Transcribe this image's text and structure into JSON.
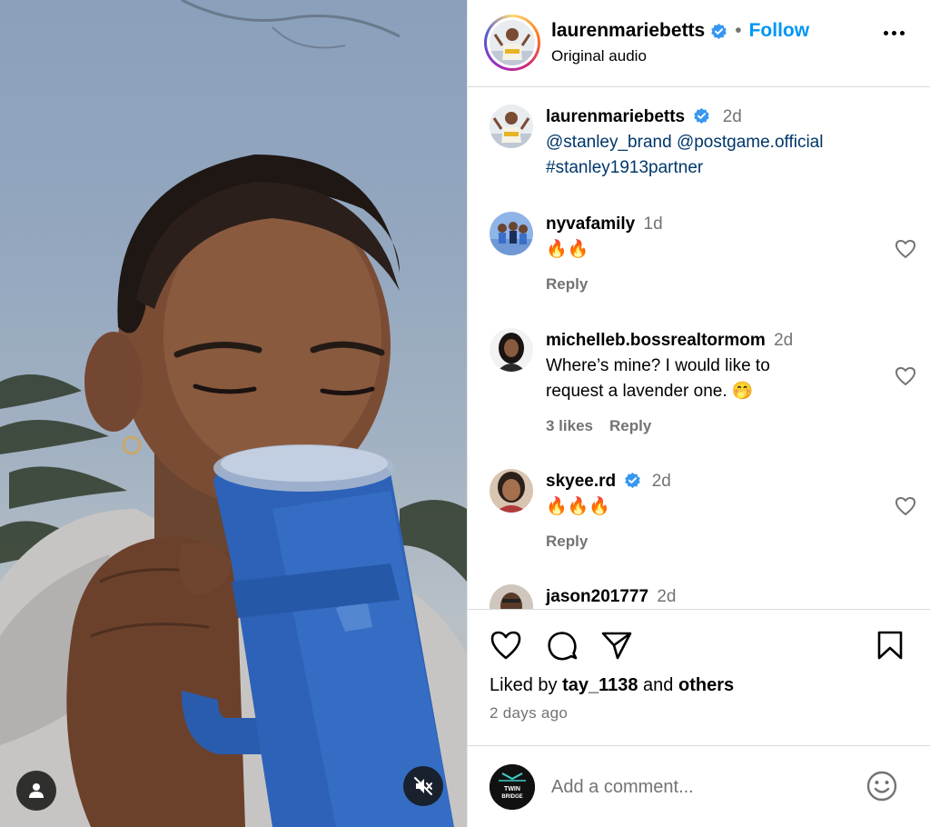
{
  "header": {
    "username": "laurenmariebetts",
    "separator": "•",
    "follow_label": "Follow",
    "audio_label": "Original audio"
  },
  "caption": {
    "username": "laurenmariebetts",
    "time": "2d",
    "mention_1": "@stanley_brand",
    "mention_2": "@postgame.official",
    "hashtag": "#stanley1913partner"
  },
  "comments": [
    {
      "username": "nyvafamily",
      "time": "1d",
      "text": "🔥🔥",
      "reply_label": "Reply"
    },
    {
      "username": "michelleb.bossrealtormom",
      "time": "2d",
      "text_line1": "Where’s mine? I would like to",
      "text_line2": "request a lavender one. 🤭",
      "likes_label": "3 likes",
      "reply_label": "Reply"
    },
    {
      "username": "skyee.rd",
      "time": "2d",
      "text": "🔥🔥🔥",
      "reply_label": "Reply"
    },
    {
      "username": "jason201777",
      "time": "2d"
    }
  ],
  "likes": {
    "prefix": "Liked by",
    "user": "tay_1138",
    "connector": "and",
    "others": "others"
  },
  "posted_ago": "2 days ago",
  "add_comment": {
    "placeholder": "Add a comment...",
    "avatar_text_1": "TWIN",
    "avatar_text_2": "BRIDGE"
  },
  "colors": {
    "link_blue": "#0095f6",
    "verified_blue": "#3897f0",
    "mention_blue": "#00376b",
    "muted_gray": "#737373",
    "tumbler_blue": "#2d62b8"
  },
  "icons": {
    "verified": "verified-badge-icon",
    "more": "more-options-icon",
    "heart": "heart-icon",
    "comment": "comment-icon",
    "share": "share-icon",
    "save": "bookmark-icon",
    "emoji": "emoji-icon",
    "tag": "user-tag-icon",
    "mute": "muted-speaker-icon"
  }
}
